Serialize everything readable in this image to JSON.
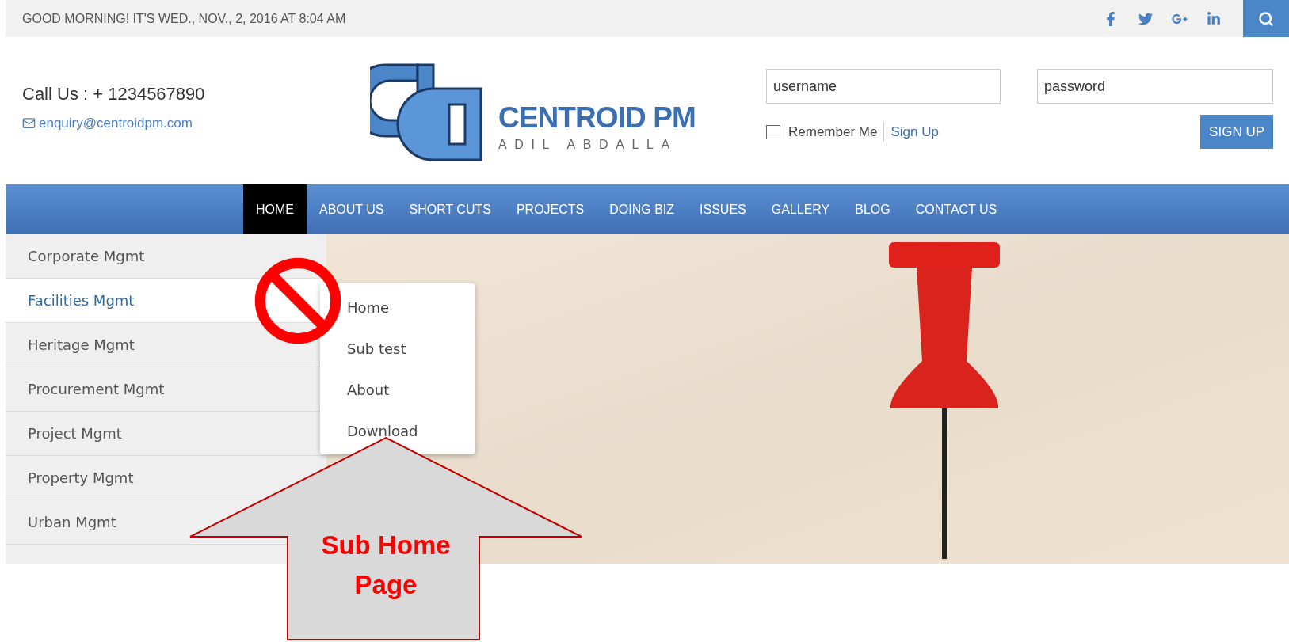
{
  "top_bar": {
    "greeting": "GOOD MORNING! IT'S WED., NOV., 2, 2016 AT 8:04 AM"
  },
  "header": {
    "call_us": "Call Us : + 1234567890",
    "email": "enquiry@centroidpm.com",
    "logo": {
      "title": "CENTROID PM",
      "subtitle": "ADIL ABDALLA"
    },
    "login": {
      "username_placeholder": "username",
      "password_placeholder": "password",
      "remember_me": {
        "label": "Remember Me",
        "checked": false
      },
      "sign_up_link": "Sign Up",
      "sign_up_button": "SIGN UP"
    }
  },
  "nav": [
    {
      "label": "HOME",
      "selected": true
    },
    {
      "label": "ABOUT US",
      "selected": false
    },
    {
      "label": "SHORT CUTS",
      "selected": false
    },
    {
      "label": "PROJECTS",
      "selected": false
    },
    {
      "label": "DOING BIZ",
      "selected": false
    },
    {
      "label": "ISSUES",
      "selected": false
    },
    {
      "label": "GALLERY",
      "selected": false
    },
    {
      "label": "BLOG",
      "selected": false
    },
    {
      "label": "CONTACT US",
      "selected": false
    }
  ],
  "sidebar": [
    {
      "label": "Corporate Mgmt",
      "selected": false
    },
    {
      "label": "Facilities Mgmt",
      "selected": true
    },
    {
      "label": "Heritage Mgmt",
      "selected": false
    },
    {
      "label": "Procurement Mgmt",
      "selected": false
    },
    {
      "label": "Project Mgmt",
      "selected": false
    },
    {
      "label": "Property Mgmt",
      "selected": false
    },
    {
      "label": "Urban Mgmt",
      "selected": false
    }
  ],
  "dropdown": [
    "Home",
    "Sub test",
    "About",
    "Download"
  ],
  "annotation": {
    "label": "Sub Home Page"
  }
}
